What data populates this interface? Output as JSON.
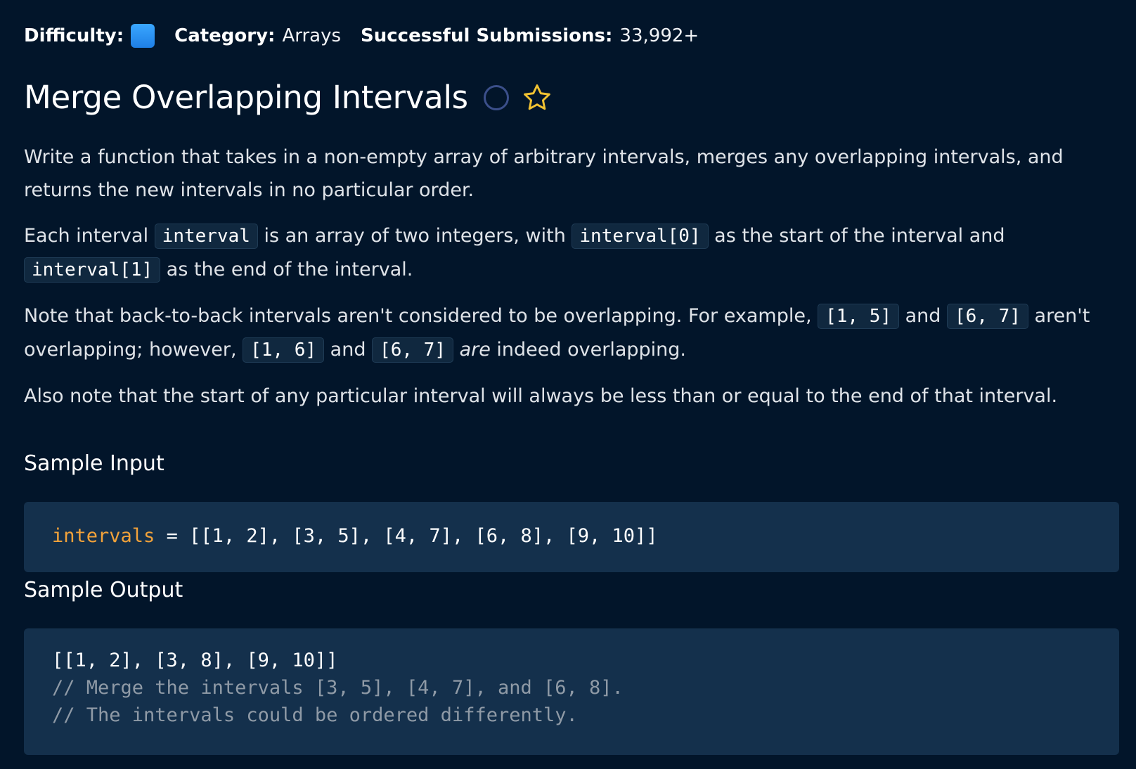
{
  "meta": {
    "difficulty_label": "Difficulty:",
    "difficulty_color": "#2b8ff0",
    "category_label": "Category:",
    "category_value": "Arrays",
    "submissions_label": "Successful Submissions:",
    "submissions_value": "33,992+"
  },
  "title": "Merge Overlapping Intervals",
  "icons": {
    "completion": "circle-outline-icon",
    "favorite": "star-outline-icon"
  },
  "prompt": {
    "p1": "Write a function that takes in a non-empty array of arbitrary intervals, merges any overlapping intervals, and returns the new intervals in no particular order.",
    "p2": {
      "t1": "Each interval ",
      "c1": "interval",
      "t2": " is an array of two integers, with ",
      "c2": "interval[0]",
      "t3": " as the start of the interval and ",
      "c3": "interval[1]",
      "t4": " as the end of the interval."
    },
    "p3": {
      "t1": "Note that back-to-back intervals aren't considered to be overlapping. For example, ",
      "c1": "[1, 5]",
      "t2": " and ",
      "c2": "[6, 7]",
      "t3": " aren't overlapping; however, ",
      "c3": "[1, 6]",
      "t4": " and ",
      "c4": "[6, 7]",
      "t5": " ",
      "em": "are",
      "t6": " indeed overlapping."
    },
    "p4": "Also note that the start of any particular interval will always be less than or equal to the end of that interval."
  },
  "sample_input": {
    "heading": "Sample Input",
    "var_name": "intervals",
    "rest": " = [[1, 2], [3, 5], [4, 7], [6, 8], [9, 10]]"
  },
  "sample_output": {
    "heading": "Sample Output",
    "line1": "[[1, 2], [3, 8], [9, 10]]",
    "line2": "// Merge the intervals [3, 5], [4, 7], and [6, 8].",
    "line3": "// The intervals could be ordered differently."
  },
  "colors": {
    "background": "#02152a",
    "code_block_bg": "#14304c",
    "inline_code_bg": "#10283f",
    "variable": "#f2a23a",
    "comment": "#8f9aa6",
    "star": "#f1c232"
  }
}
